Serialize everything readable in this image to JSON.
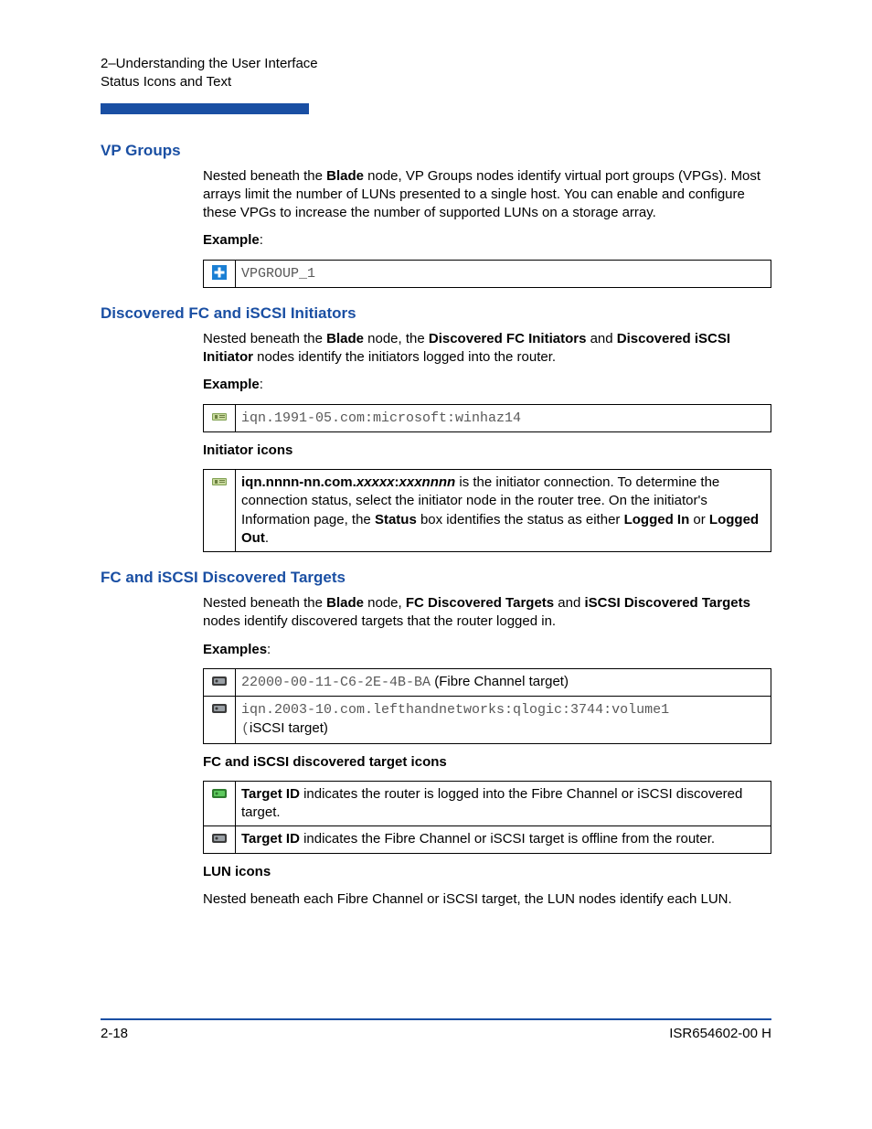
{
  "header": {
    "line1": "2–Understanding the User Interface",
    "line2": "Status Icons and Text"
  },
  "sections": {
    "vp": {
      "title": "VP Groups",
      "para_pre": "Nested beneath the ",
      "para_bold1": "Blade",
      "para_post": " node, VP Groups nodes identify virtual port groups (VPGs). Most arrays limit the number of LUNs presented to a single host. You can enable and configure these VPGs to increase the number of supported LUNs on a storage array.",
      "example_label": "Example",
      "example_value": "VPGROUP_1"
    },
    "disc_init": {
      "title": "Discovered FC and iSCSI Initiators",
      "para_pre": "Nested beneath the ",
      "b1": "Blade",
      "mid1": " node, the ",
      "b2": "Discovered FC Initiators",
      "mid2": " and ",
      "b3": "Discovered iSCSI Initiator",
      "post": " nodes identify the initiators logged into the router.",
      "example_label": "Example",
      "example_value": "iqn.1991-05.com:microsoft:winhaz14",
      "init_icons_label": "Initiator icons",
      "init_row": {
        "b1": "iqn.nnnn-nn.com.",
        "i1": "xxxxx",
        "b2": ":",
        "i2": "xxxnnnn",
        "mid": " is the initiator connection. To determine the connection status, select the initiator node in the router tree. On the initiator's Information page, the ",
        "b3": "Status",
        "mid2": " box identifies the status as either ",
        "b4": "Logged In",
        "mid3": " or ",
        "b5": "Logged Out",
        "end": "."
      }
    },
    "disc_targ": {
      "title": "FC and iSCSI Discovered Targets",
      "para_pre": "Nested beneath the ",
      "b1": "Blade",
      "mid1": " node, ",
      "b2": "FC Discovered Targets",
      "mid2": " and ",
      "b3": "iSCSI Discovered Targets",
      "post": " nodes identify discovered targets that the router logged in.",
      "examples_label": "Examples",
      "ex1_mono": "22000-00-11-C6-2E-4B-BA",
      "ex1_tail": " (Fibre Channel target)",
      "ex2_mono": "iqn.2003-10.com.lefthandnetworks:qlogic:3744:volume1",
      "ex2_tail_pre": "(",
      "ex2_tail": "iSCSI target)",
      "target_icons_label": "FC and iSCSI discovered target icons",
      "t1_b": "Target ID",
      "t1_t": " indicates the router is logged into the Fibre Channel or iSCSI discovered target.",
      "t2_b": "Target ID",
      "t2_t": " indicates the Fibre Channel or iSCSI target is offline from the router.",
      "lun_label": "LUN icons",
      "lun_para": "Nested beneath each Fibre Channel or iSCSI target, the LUN nodes identify each LUN."
    }
  },
  "footer": {
    "left": "2-18",
    "right": "ISR654602-00  H"
  }
}
